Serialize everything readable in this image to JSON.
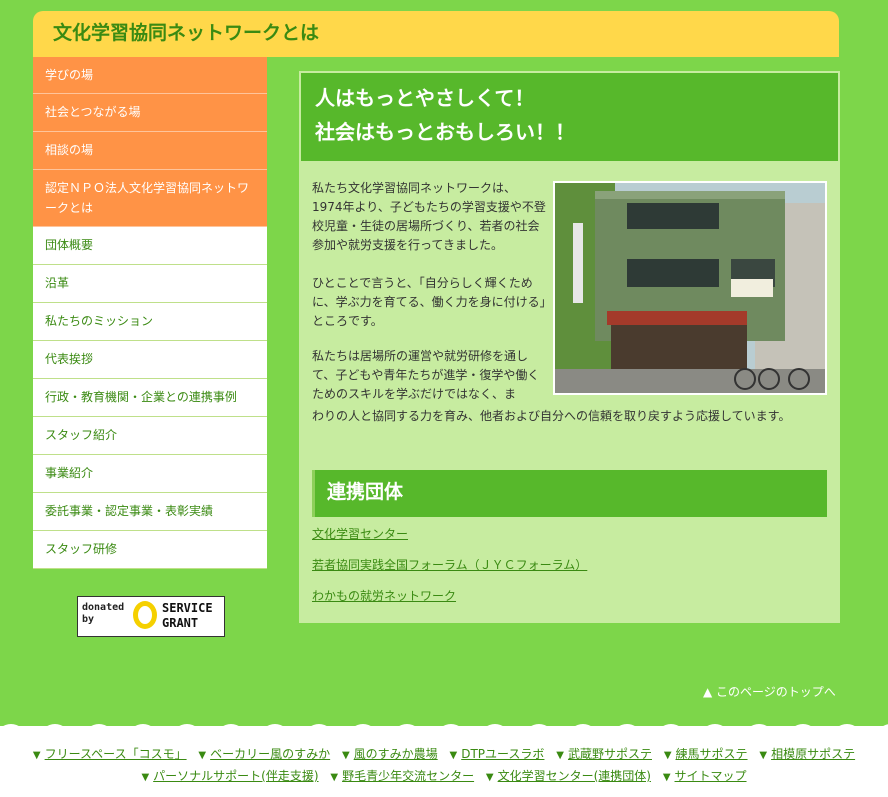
{
  "header": {
    "title": "文化学習協同ネットワークとは"
  },
  "sidebar": {
    "items": [
      {
        "label": "学びの場"
      },
      {
        "label": "社会とつながる場"
      },
      {
        "label": "相談の場"
      },
      {
        "label": "認定ＮＰＯ法人文化学習協同ネットワークとは"
      },
      {
        "label": "団体概要"
      },
      {
        "label": "沿革"
      },
      {
        "label": "私たちのミッション"
      },
      {
        "label": "代表挨拶"
      },
      {
        "label": "行政・教育機関・企業との連携事例"
      },
      {
        "label": "スタッフ紹介"
      },
      {
        "label": "事業紹介"
      },
      {
        "label": "委託事業・認定事業・表彰実績"
      },
      {
        "label": "スタッフ研修"
      }
    ]
  },
  "badge": {
    "donated": "donated by",
    "service": "SERVICE",
    "grant": "GRANT"
  },
  "main": {
    "hero_line1": "人はもっとやさしくて！",
    "hero_line2": "社会はもっとおもしろい！！",
    "para1": "私たち文化学習協同ネットワークは、1974年より、子どもたちの学習支援や不登校児童・生徒の居場所づくり、若者の社会参加や就労支援を行ってきました。",
    "para2": "ひとことで言うと、「自分らしく輝くために、学ぶ力を育てる、働く力を身に付ける」ところです。",
    "para3a": "私たちは居場所の運営や就労研修を通して、子どもや青年たちが進学・復学や働くためのスキルを学ぶだけではなく、ま",
    "para3b": "わりの人と協同する力を育み、他者および自分への信頼を取り戻すよう応援しています。",
    "section_title": "連携団体",
    "links": [
      "文化学習センター",
      "若者協同実践全国フォーラム（ＪＹＣフォーラム）",
      "わかもの就労ネットワーク"
    ]
  },
  "totop": "▲ このページのトップへ",
  "footer": {
    "row1": [
      "フリースペース「コスモ」",
      "ベーカリー風のすみか",
      "風のすみか農場",
      "DTPユースラボ",
      "武蔵野サポステ",
      "練馬サポステ",
      "相模原サポステ"
    ],
    "row2": [
      "パーソナルサポート(伴走支援)",
      "野毛青少年交流センター",
      "文化学習センター(連携団体)",
      "サイトマップ"
    ],
    "arrow": "▼"
  },
  "colors": {
    "background": "#7dd64a",
    "header": "#ffd84a",
    "orange": "#ff9346",
    "green": "#57b82b",
    "panel": "#c7eca0"
  }
}
